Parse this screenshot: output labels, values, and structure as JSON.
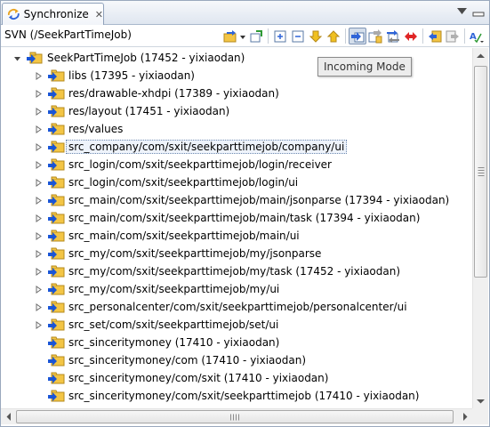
{
  "view_tab": {
    "title": "Synchronize",
    "icon": "synchronize-view-icon",
    "close_icon": "close-icon"
  },
  "view_menu": {
    "minimize_icon": "minimize-icon",
    "menu_icon": "view-menu-icon"
  },
  "repository_title": "SVN (/SeekPartTimeJob)",
  "toolbar": [
    {
      "name": "synchronize-dropdown-button",
      "icon": "synchronize-icon"
    },
    {
      "name": "pin-button",
      "icon": "pin-icon"
    },
    {
      "name": "expand-all-button",
      "icon": "expand-all-icon"
    },
    {
      "name": "collapse-all-button",
      "icon": "collapse-all-icon"
    },
    {
      "name": "next-difference-button",
      "icon": "arrow-down-icon"
    },
    {
      "name": "previous-difference-button",
      "icon": "arrow-up-icon"
    },
    {
      "name": "incoming-mode-button",
      "icon": "incoming-mode-icon",
      "active": true
    },
    {
      "name": "outgoing-mode-button",
      "icon": "outgoing-mode-icon"
    },
    {
      "name": "incoming-outgoing-mode-button",
      "icon": "incoming-outgoing-mode-icon"
    },
    {
      "name": "conflicts-mode-button",
      "icon": "conflicts-mode-icon"
    },
    {
      "name": "update-all-button",
      "icon": "update-all-icon"
    },
    {
      "name": "commit-all-button",
      "icon": "commit-all-icon"
    },
    {
      "name": "presentation-menu-button",
      "icon": "presentation-icon"
    }
  ],
  "tooltip": "Incoming Mode",
  "colors": {
    "incoming_arrow": "#1a55d6",
    "folder": "#f3c545",
    "selection_border": "#6f8ab0"
  },
  "tree": {
    "root": {
      "label": "SeekPartTimeJob (17452 - yixiaodan)",
      "icon": "project-incoming-icon",
      "expanded": true
    },
    "items": [
      {
        "label": "libs (17395 - yixiaodan)",
        "icon": "folder-incoming-icon",
        "level": 1,
        "twisty": true
      },
      {
        "label": "res/drawable-xhdpi (17389 - yixiaodan)",
        "icon": "folder-incoming-icon",
        "level": 1,
        "twisty": true
      },
      {
        "label": "res/layout (17451 - yixiaodan)",
        "icon": "folder-incoming-icon",
        "level": 1,
        "twisty": true
      },
      {
        "label": "res/values",
        "icon": "folder-incoming-icon",
        "level": 1,
        "twisty": true
      },
      {
        "label": "src_company/com/sxit/seekparttimejob/company/ui",
        "icon": "folder-incoming-icon",
        "level": 1,
        "twisty": true,
        "selected": true
      },
      {
        "label": "src_login/com/sxit/seekparttimejob/login/receiver",
        "icon": "folder-incoming-icon",
        "level": 1,
        "twisty": true
      },
      {
        "label": "src_login/com/sxit/seekparttimejob/login/ui",
        "icon": "folder-incoming-icon",
        "level": 1,
        "twisty": true
      },
      {
        "label": "src_main/com/sxit/seekparttimejob/main/jsonparse (17394 - yixiaodan)",
        "icon": "folder-incoming-icon",
        "level": 1,
        "twisty": true
      },
      {
        "label": "src_main/com/sxit/seekparttimejob/main/task (17394 - yixiaodan)",
        "icon": "folder-incoming-icon",
        "level": 1,
        "twisty": true
      },
      {
        "label": "src_main/com/sxit/seekparttimejob/main/ui",
        "icon": "folder-incoming-icon",
        "level": 1,
        "twisty": true
      },
      {
        "label": "src_my/com/sxit/seekparttimejob/my/jsonparse",
        "icon": "folder-incoming-icon",
        "level": 1,
        "twisty": true
      },
      {
        "label": "src_my/com/sxit/seekparttimejob/my/task (17452 - yixiaodan)",
        "icon": "folder-incoming-icon",
        "level": 1,
        "twisty": true
      },
      {
        "label": "src_my/com/sxit/seekparttimejob/my/ui",
        "icon": "folder-incoming-icon",
        "level": 1,
        "twisty": true
      },
      {
        "label": "src_personalcenter/com/sxit/seekparttimejob/personalcenter/ui",
        "icon": "folder-incoming-icon",
        "level": 1,
        "twisty": true
      },
      {
        "label": "src_set/com/sxit/seekparttimejob/set/ui",
        "icon": "folder-incoming-icon",
        "level": 1,
        "twisty": true
      },
      {
        "label": "src_sinceritymoney (17410 - yixiaodan)",
        "icon": "folder-incoming-icon",
        "level": 1,
        "twisty": false
      },
      {
        "label": "src_sinceritymoney/com (17410 - yixiaodan)",
        "icon": "folder-incoming-icon",
        "level": 1,
        "twisty": false
      },
      {
        "label": "src_sinceritymoney/com/sxit (17410 - yixiaodan)",
        "icon": "folder-incoming-icon",
        "level": 1,
        "twisty": false
      },
      {
        "label": "src_sinceritymoney/com/sxit/seekparttimejob (17410 - yixiaodan)",
        "icon": "folder-incoming-icon",
        "level": 1,
        "twisty": false
      }
    ]
  }
}
